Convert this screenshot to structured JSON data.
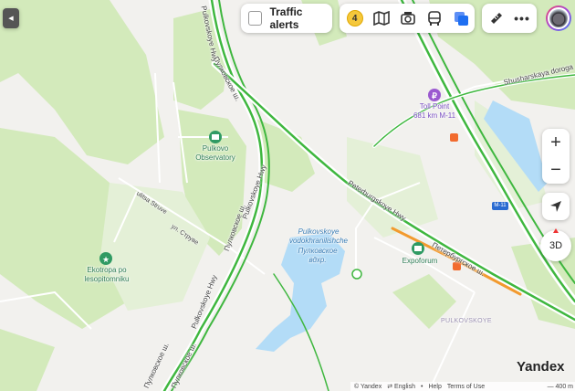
{
  "top_bar": {
    "traffic_alerts_label": "Traffic alerts",
    "traffic_level": "4"
  },
  "map_labels": {
    "observatory": "Pulkovo\nObservatory",
    "toll_point": "Toll Point\n681 km M-11",
    "ekotropa": "Ekotropa po\nlesopitomniku",
    "reservoir_en": "Pulkovskoye\nvodokhranilishche",
    "reservoir_ru": "Пулковское\nвдхр.",
    "expoforum": "Expoforum",
    "pulkovskoye_district": "PULKOVSKOYE",
    "m11_shield": "M-11",
    "shusharskaya": "Shusharskaya doroga",
    "peterburgskoye_hwy": "Peterburgskoye Hwy",
    "peterburgskoe_sh": "Петербургское ш.",
    "pulkovskoye_hwy_1": "Pulkovskoye Hwy",
    "pulkovskoye_hwy_2": "Pulkovskoye Hwy",
    "pulkovskoye_sh_1": "Пулковское ш.",
    "pulkovskoye_sh_2": "Пулковское ш.",
    "pulkovskoye_sh_3": "Пулковское ш.",
    "pulkovskoye_sh_4": "Пулковское ш.",
    "pulkovskoye_hwy_top": "Pulkovskoye Hwy",
    "ulitsa_struve": "ulitsa Struve",
    "ul_struve": "ул. Струве"
  },
  "controls": {
    "zoom_in": "+",
    "zoom_out": "−",
    "three_d": "3D"
  },
  "footer": {
    "brand": "Yandex",
    "copyright": "© Yandex",
    "language": "English",
    "help": "Help",
    "terms": "Terms of Use",
    "scale": "400 m"
  },
  "colors": {
    "land": "#f2f1ee",
    "park": "#cfe8b6",
    "water": "#b3dcf7",
    "traffic_green": "#3fb73f",
    "traffic_orange": "#f29a2e",
    "accent_blue": "#1e6ff1"
  }
}
